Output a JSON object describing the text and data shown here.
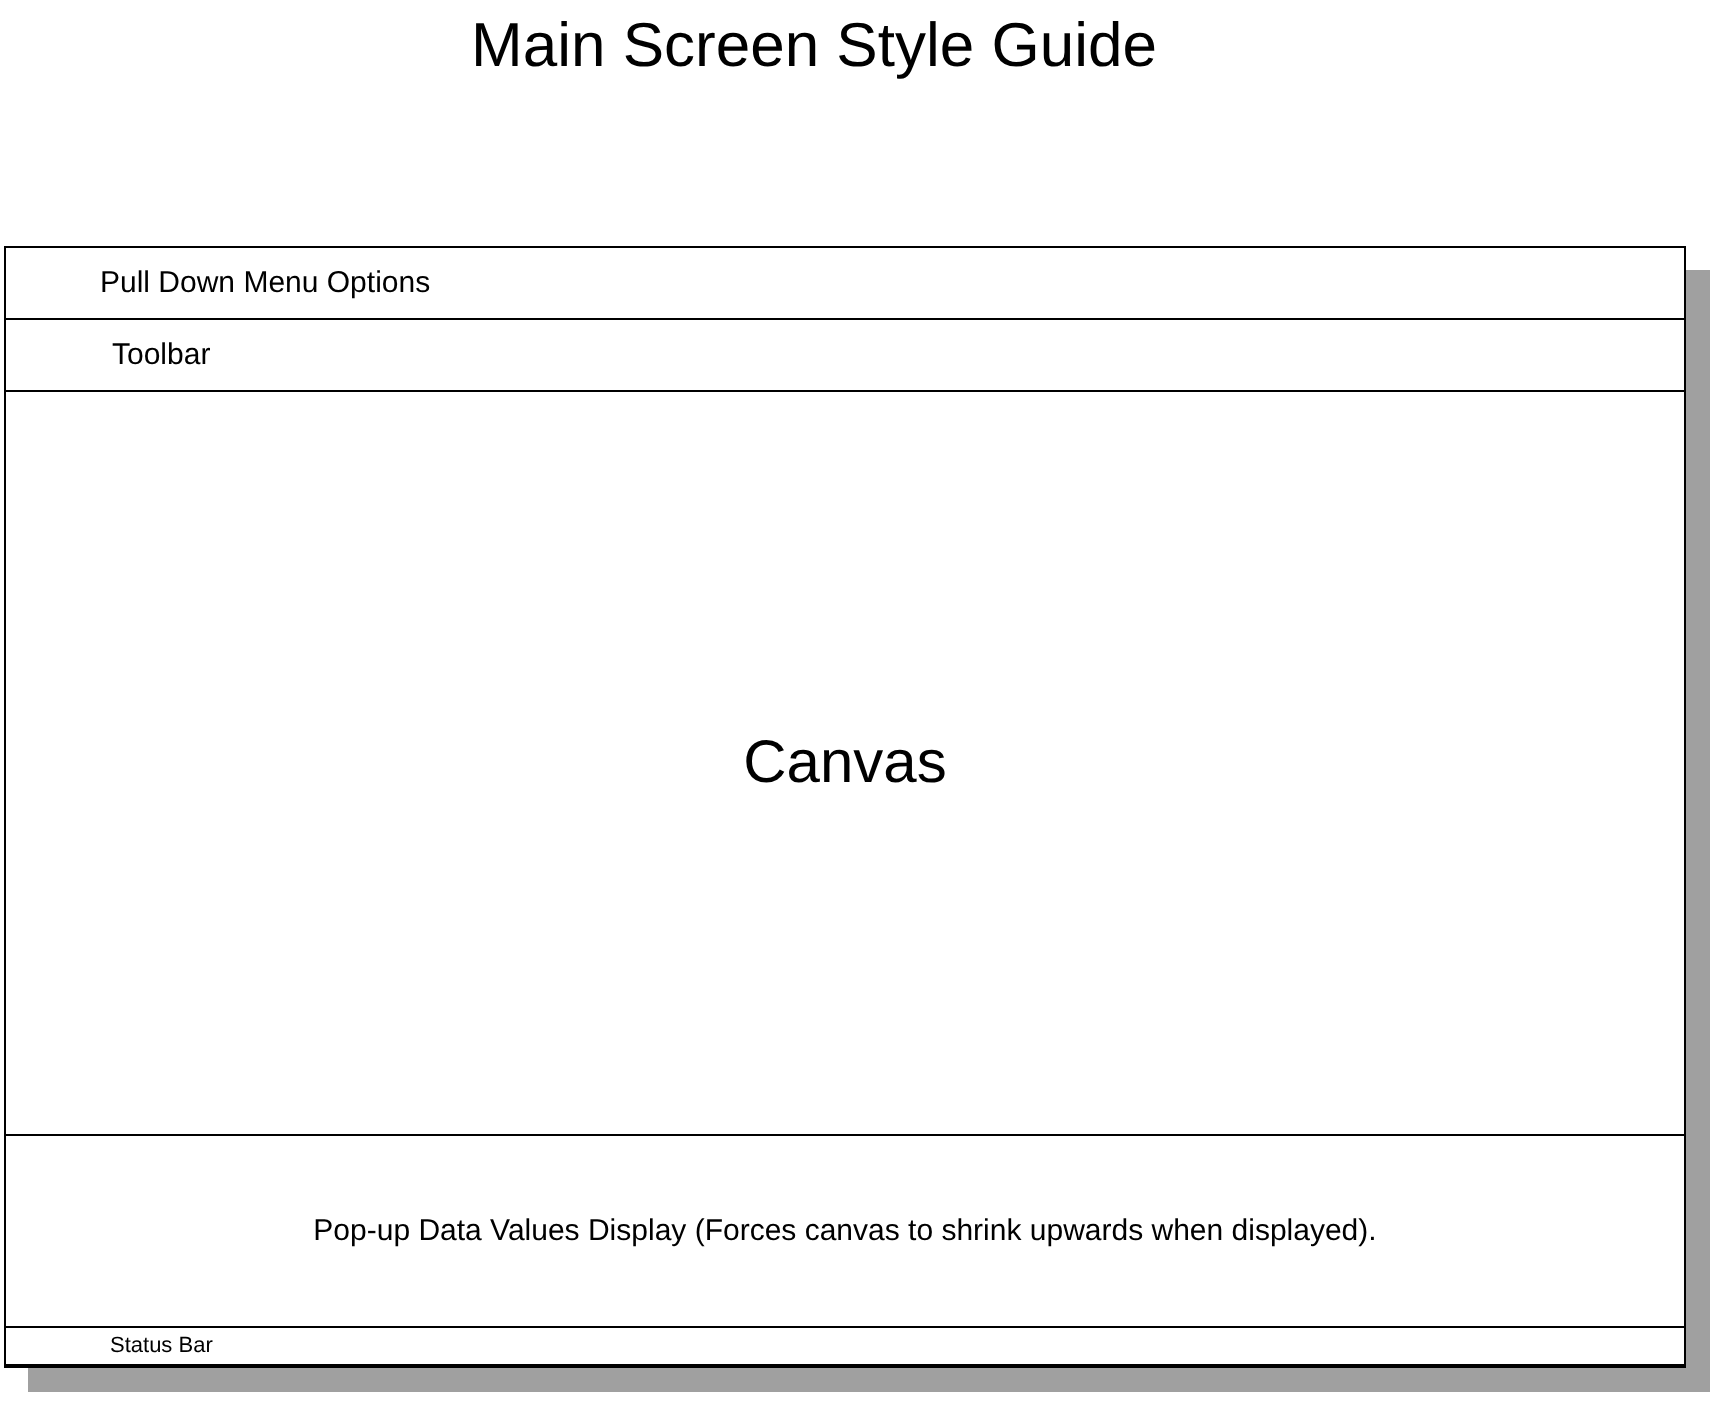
{
  "title": "Main Screen Style Guide",
  "window": {
    "menu_bar": "Pull Down Menu Options",
    "toolbar": "Toolbar",
    "canvas": "Canvas",
    "popup_display": "Pop-up Data Values Display (Forces canvas to shrink upwards when displayed).",
    "status_bar": "Status Bar"
  }
}
